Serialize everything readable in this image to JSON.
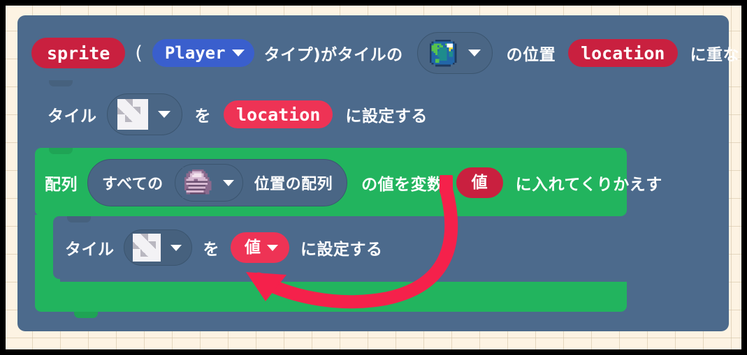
{
  "meta": {
    "app": "MakeCode Arcade Block Editor",
    "language": "ja"
  },
  "colors": {
    "canvas_background": "#FDF3E3",
    "grid_line": "#D0BEA0",
    "block_slate": "#4C6A8C",
    "block_green": "#22B45E",
    "chip_crimson": "#C9203F",
    "chip_pink": "#EE3355",
    "chip_blue": "#3A5FCD",
    "slot_slate": "#4A6685",
    "arrow_red": "#F5214B",
    "text_white": "#FFFFFF",
    "frame_black": "#000000"
  },
  "blocks": {
    "event_header": {
      "name": "on-sprite-overlaps-tile-event",
      "sprite_chip": "sprite",
      "open_paren": "(",
      "kind_dropdown": "Player",
      "text_after_kind": "タイプ)がタイルの",
      "tile_icon": "earth-globe-tile",
      "text_after_tile": "の位置",
      "location_chip": "location",
      "text_tail": "に重なった時"
    },
    "set_tile_1": {
      "name": "set-tile-at-location",
      "label_prefix": "タイル",
      "tile_icon": "transparency-checker-tile",
      "label_middle": "を",
      "value_chip": "location",
      "label_suffix": "に設定する"
    },
    "for_each": {
      "name": "for-each-of-tile-locations",
      "label_prefix": "配列",
      "oval_text_start": "すべての",
      "tile_icon": "rock-tile",
      "oval_text_end": "位置の配列",
      "label_middle": "の値を変数",
      "variable_chip": "値",
      "label_suffix": "に入れてくりかえす"
    },
    "set_tile_2": {
      "name": "set-tile-at-value",
      "label_prefix": "タイル",
      "tile_icon": "transparency-checker-tile",
      "label_middle": "を",
      "value_dropdown": "値",
      "label_suffix": "に設定する"
    }
  },
  "annotation": {
    "name": "curved-red-arrow",
    "description": "value-variable-to-tile-location-link",
    "from": "for_each.variable_chip",
    "to": "set_tile_2.value_dropdown"
  }
}
